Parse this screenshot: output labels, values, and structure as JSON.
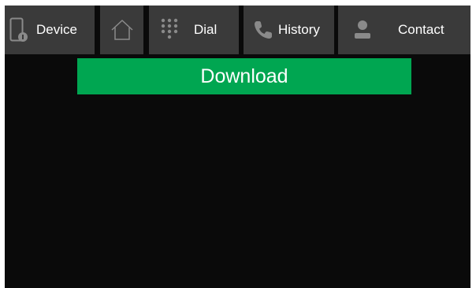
{
  "nav": {
    "tabs": [
      {
        "label": "Device",
        "icon": "phone-device-icon"
      },
      {
        "label": "",
        "icon": "home-icon"
      },
      {
        "label": "Dial",
        "icon": "dialpad-icon"
      },
      {
        "label": "History",
        "icon": "phone-handset-icon"
      },
      {
        "label": "Contact",
        "icon": "person-icon"
      }
    ]
  },
  "main": {
    "download_label": "Download"
  },
  "colors": {
    "accent": "#00a651",
    "tab_background": "#3a3a3a",
    "screen_background": "#0a0a0a",
    "icon_gray": "#8a8a8a"
  }
}
